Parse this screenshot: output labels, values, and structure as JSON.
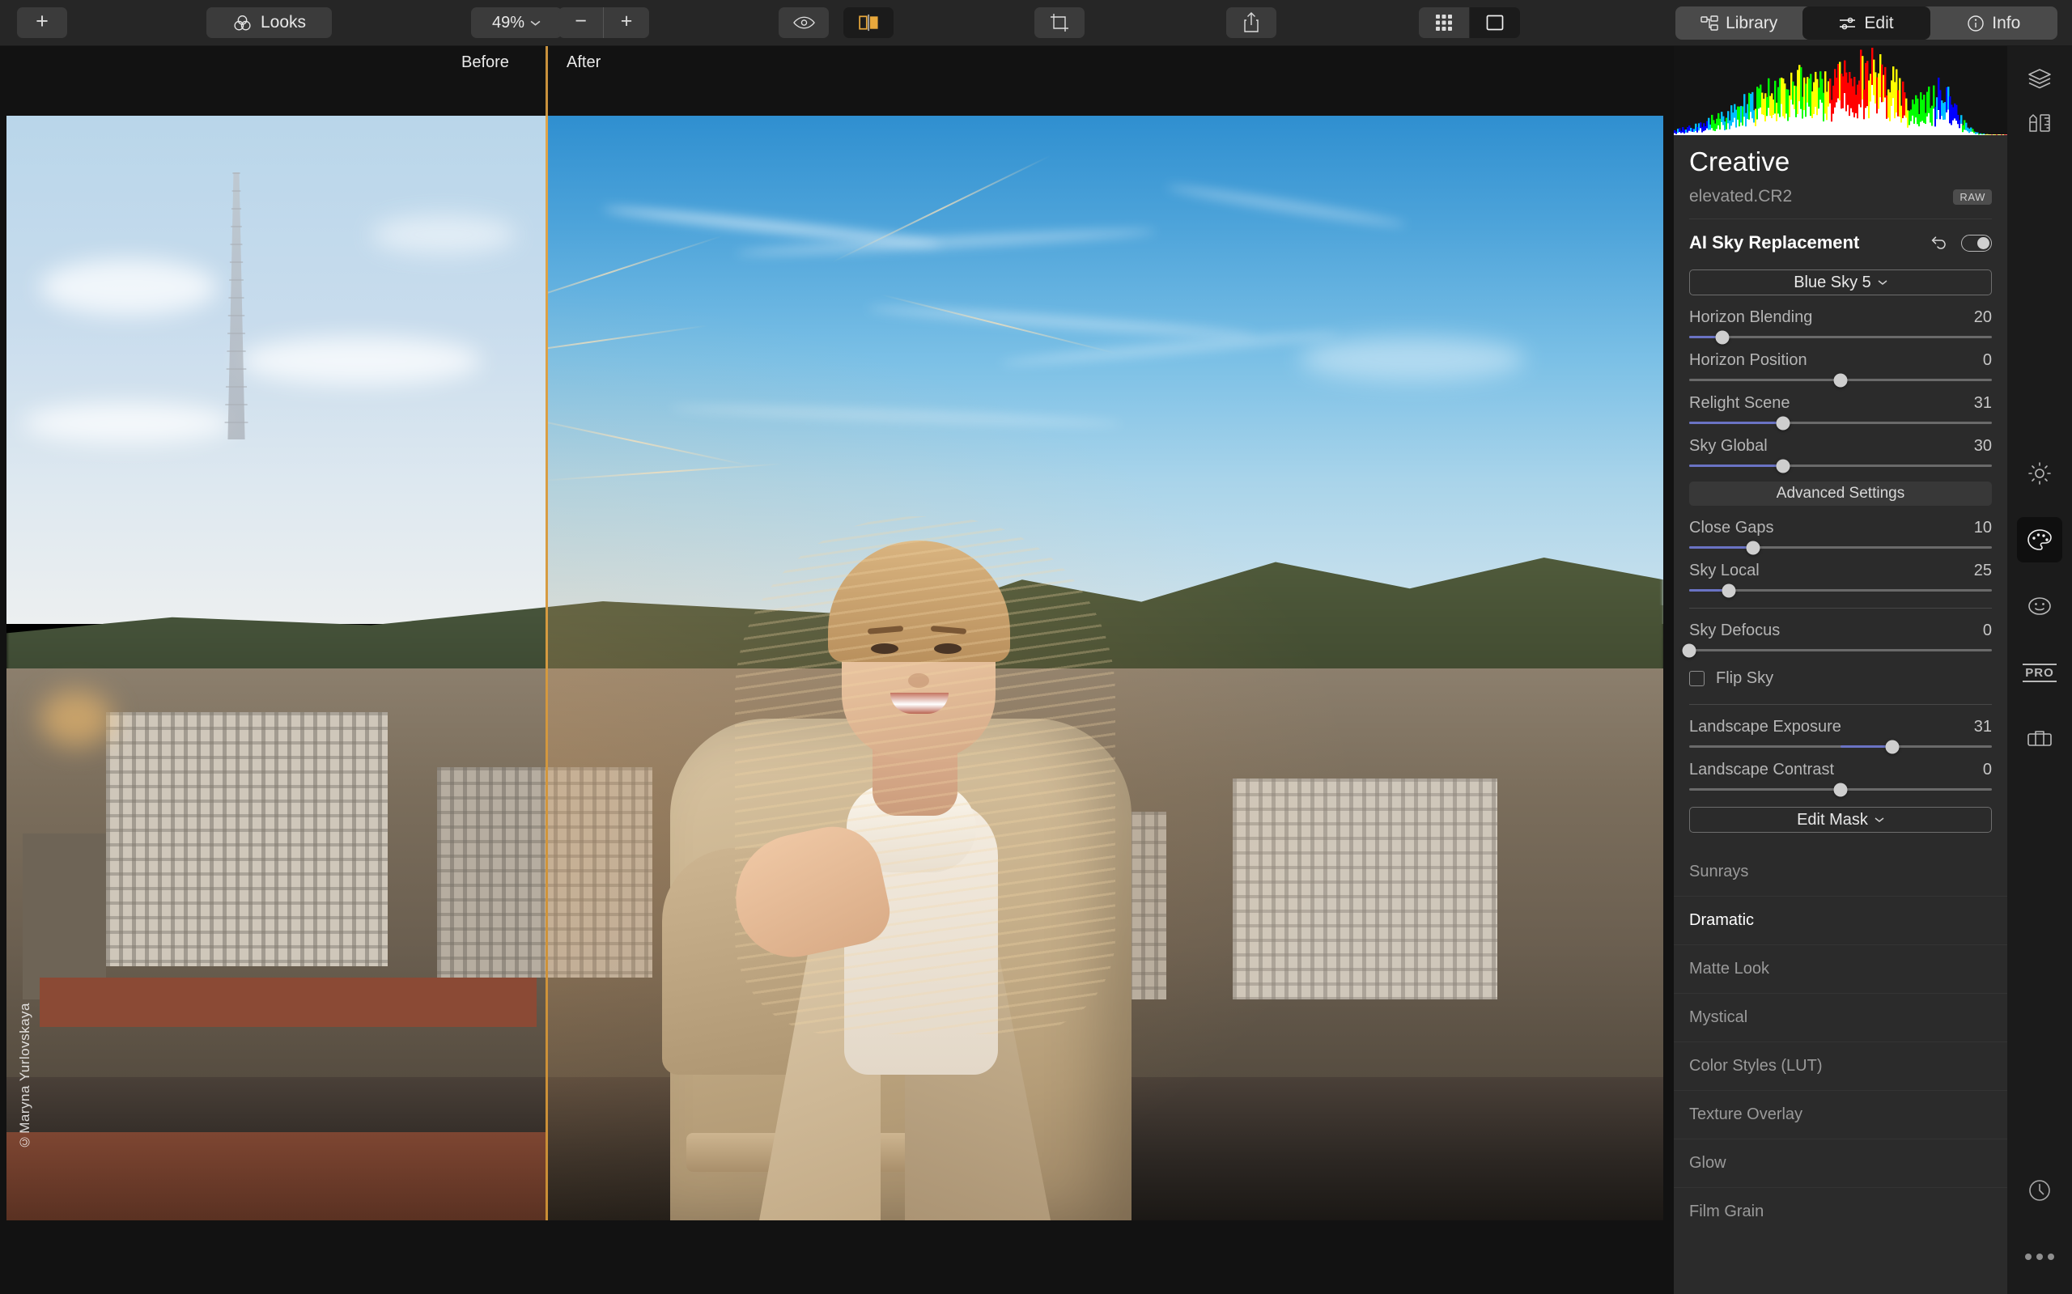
{
  "toolbar": {
    "add_label": "+",
    "looks_label": "Looks",
    "zoom_level": "49%",
    "zoom_out_label": "−",
    "zoom_in_label": "+",
    "icons": {
      "looks": "venn-circles-icon",
      "eye": "eye-icon",
      "compare": "split-compare-icon",
      "crop": "crop-icon",
      "share": "share-export-icon",
      "grid": "grid-view-icon",
      "single": "single-view-icon"
    },
    "tabs": [
      {
        "label": "Library",
        "icon": "library-icon",
        "active": false
      },
      {
        "label": "Edit",
        "icon": "sliders-icon",
        "active": true
      },
      {
        "label": "Info",
        "icon": "info-icon",
        "active": false
      }
    ]
  },
  "canvas": {
    "before_label": "Before",
    "after_label": "After",
    "watermark": "©Maryna Yurlovskaya"
  },
  "panel": {
    "title": "Creative",
    "filename": "elevated.CR2",
    "format_badge": "RAW",
    "section": {
      "title": "AI Sky Replacement",
      "reset_icon": "undo-reset-icon",
      "toggle_on": true,
      "preset": "Blue Sky 5",
      "advanced_label": "Advanced Settings",
      "edit_mask_label": "Edit Mask",
      "flip_sky_label": "Flip Sky",
      "flip_sky_checked": false
    },
    "sliders": [
      {
        "label": "Horizon Blending",
        "value": "20",
        "pos": 11,
        "fill_from": 0,
        "fill_to": 11
      },
      {
        "label": "Horizon Position",
        "value": "0",
        "pos": 50,
        "fill_from": 50,
        "fill_to": 50
      },
      {
        "label": "Relight Scene",
        "value": "31",
        "pos": 31,
        "fill_from": 0,
        "fill_to": 31
      },
      {
        "label": "Sky Global",
        "value": "30",
        "pos": 31,
        "fill_from": 0,
        "fill_to": 31
      },
      {
        "label": "Close Gaps",
        "value": "10",
        "pos": 21,
        "fill_from": 0,
        "fill_to": 21
      },
      {
        "label": "Sky Local",
        "value": "25",
        "pos": 13,
        "fill_from": 0,
        "fill_to": 13
      },
      {
        "label": "Sky Defocus",
        "value": "0",
        "pos": 0,
        "fill_from": 0,
        "fill_to": 0
      },
      {
        "label": "Landscape Exposure",
        "value": "31",
        "pos": 67,
        "fill_from": 50,
        "fill_to": 67
      },
      {
        "label": "Landscape Contrast",
        "value": "0",
        "pos": 50,
        "fill_from": 50,
        "fill_to": 50
      }
    ],
    "tools": [
      {
        "label": "Sunrays",
        "active": false
      },
      {
        "label": "Dramatic",
        "active": true
      },
      {
        "label": "Matte Look",
        "active": false
      },
      {
        "label": "Mystical",
        "active": false
      },
      {
        "label": "Color Styles (LUT)",
        "active": false
      },
      {
        "label": "Texture Overlay",
        "active": false
      },
      {
        "label": "Glow",
        "active": false
      },
      {
        "label": "Film Grain",
        "active": false
      }
    ]
  },
  "rail": {
    "icons": [
      {
        "name": "layers-icon",
        "active": false
      },
      {
        "name": "tools-pen-ruler-icon",
        "active": false
      },
      {
        "name": "essentials-sun-icon",
        "active": false
      },
      {
        "name": "creative-palette-icon",
        "active": true
      },
      {
        "name": "portrait-face-icon",
        "active": false
      },
      {
        "name": "pro-icon",
        "active": false
      },
      {
        "name": "toolkit-briefcase-icon",
        "active": false
      },
      {
        "name": "history-clock-icon",
        "active": false
      },
      {
        "name": "more-dots-icon",
        "active": false
      }
    ],
    "pro_label": "PRO"
  },
  "colors": {
    "accent_orange": "#e0a54a",
    "slider_fill": "#6a73c4",
    "panel_bg": "#2b2b2b",
    "toolbar_bg": "#262626",
    "rail_bg": "#1b1b1b"
  }
}
